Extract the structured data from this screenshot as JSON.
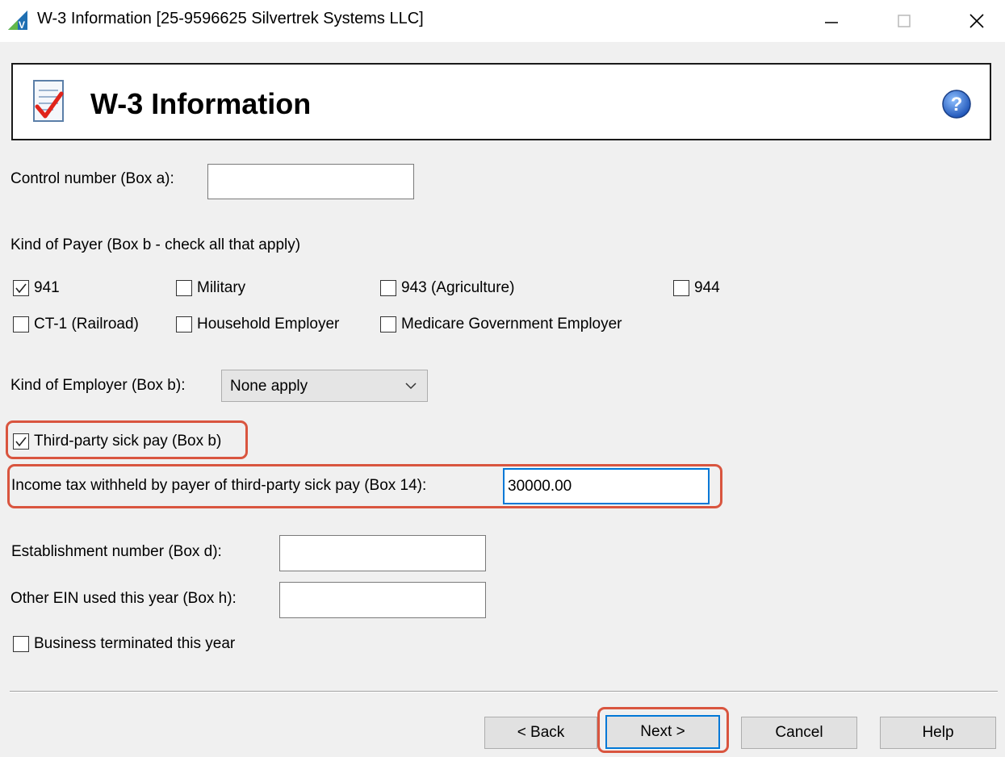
{
  "window": {
    "app_icon_letter": "V",
    "title": "W-3 Information [25-9596625 Silvertrek Systems LLC]"
  },
  "header": {
    "title": "W-3 Information",
    "help_glyph": "?"
  },
  "form": {
    "control_number": {
      "label": "Control number (Box a):",
      "value": ""
    },
    "kind_of_payer": {
      "label": "Kind of Payer (Box b - check all that apply)",
      "options": [
        {
          "label": "941",
          "checked": true
        },
        {
          "label": "Military",
          "checked": false
        },
        {
          "label": "943 (Agriculture)",
          "checked": false
        },
        {
          "label": "944",
          "checked": false
        },
        {
          "label": "CT-1 (Railroad)",
          "checked": false
        },
        {
          "label": "Household Employer",
          "checked": false
        },
        {
          "label": "Medicare Government Employer",
          "checked": false
        }
      ]
    },
    "kind_of_employer": {
      "label": "Kind of Employer (Box b):",
      "selected": "None apply"
    },
    "third_party_sick_pay": {
      "label": "Third-party sick pay (Box b)",
      "checked": true
    },
    "income_tax_withheld": {
      "label": "Income tax withheld by payer of third-party sick pay (Box 14):",
      "value": "30000.00"
    },
    "establishment_number": {
      "label": "Establishment number (Box d):",
      "value": ""
    },
    "other_ein": {
      "label": "Other EIN used this year (Box h):",
      "value": ""
    },
    "business_terminated": {
      "label": "Business terminated this year",
      "checked": false
    }
  },
  "buttons": {
    "back": "< Back",
    "next": "Next >",
    "cancel": "Cancel",
    "help": "Help"
  },
  "colors": {
    "highlight": "#d9553f",
    "focus": "#0078d7",
    "help_icon": "#2d6fd0"
  }
}
